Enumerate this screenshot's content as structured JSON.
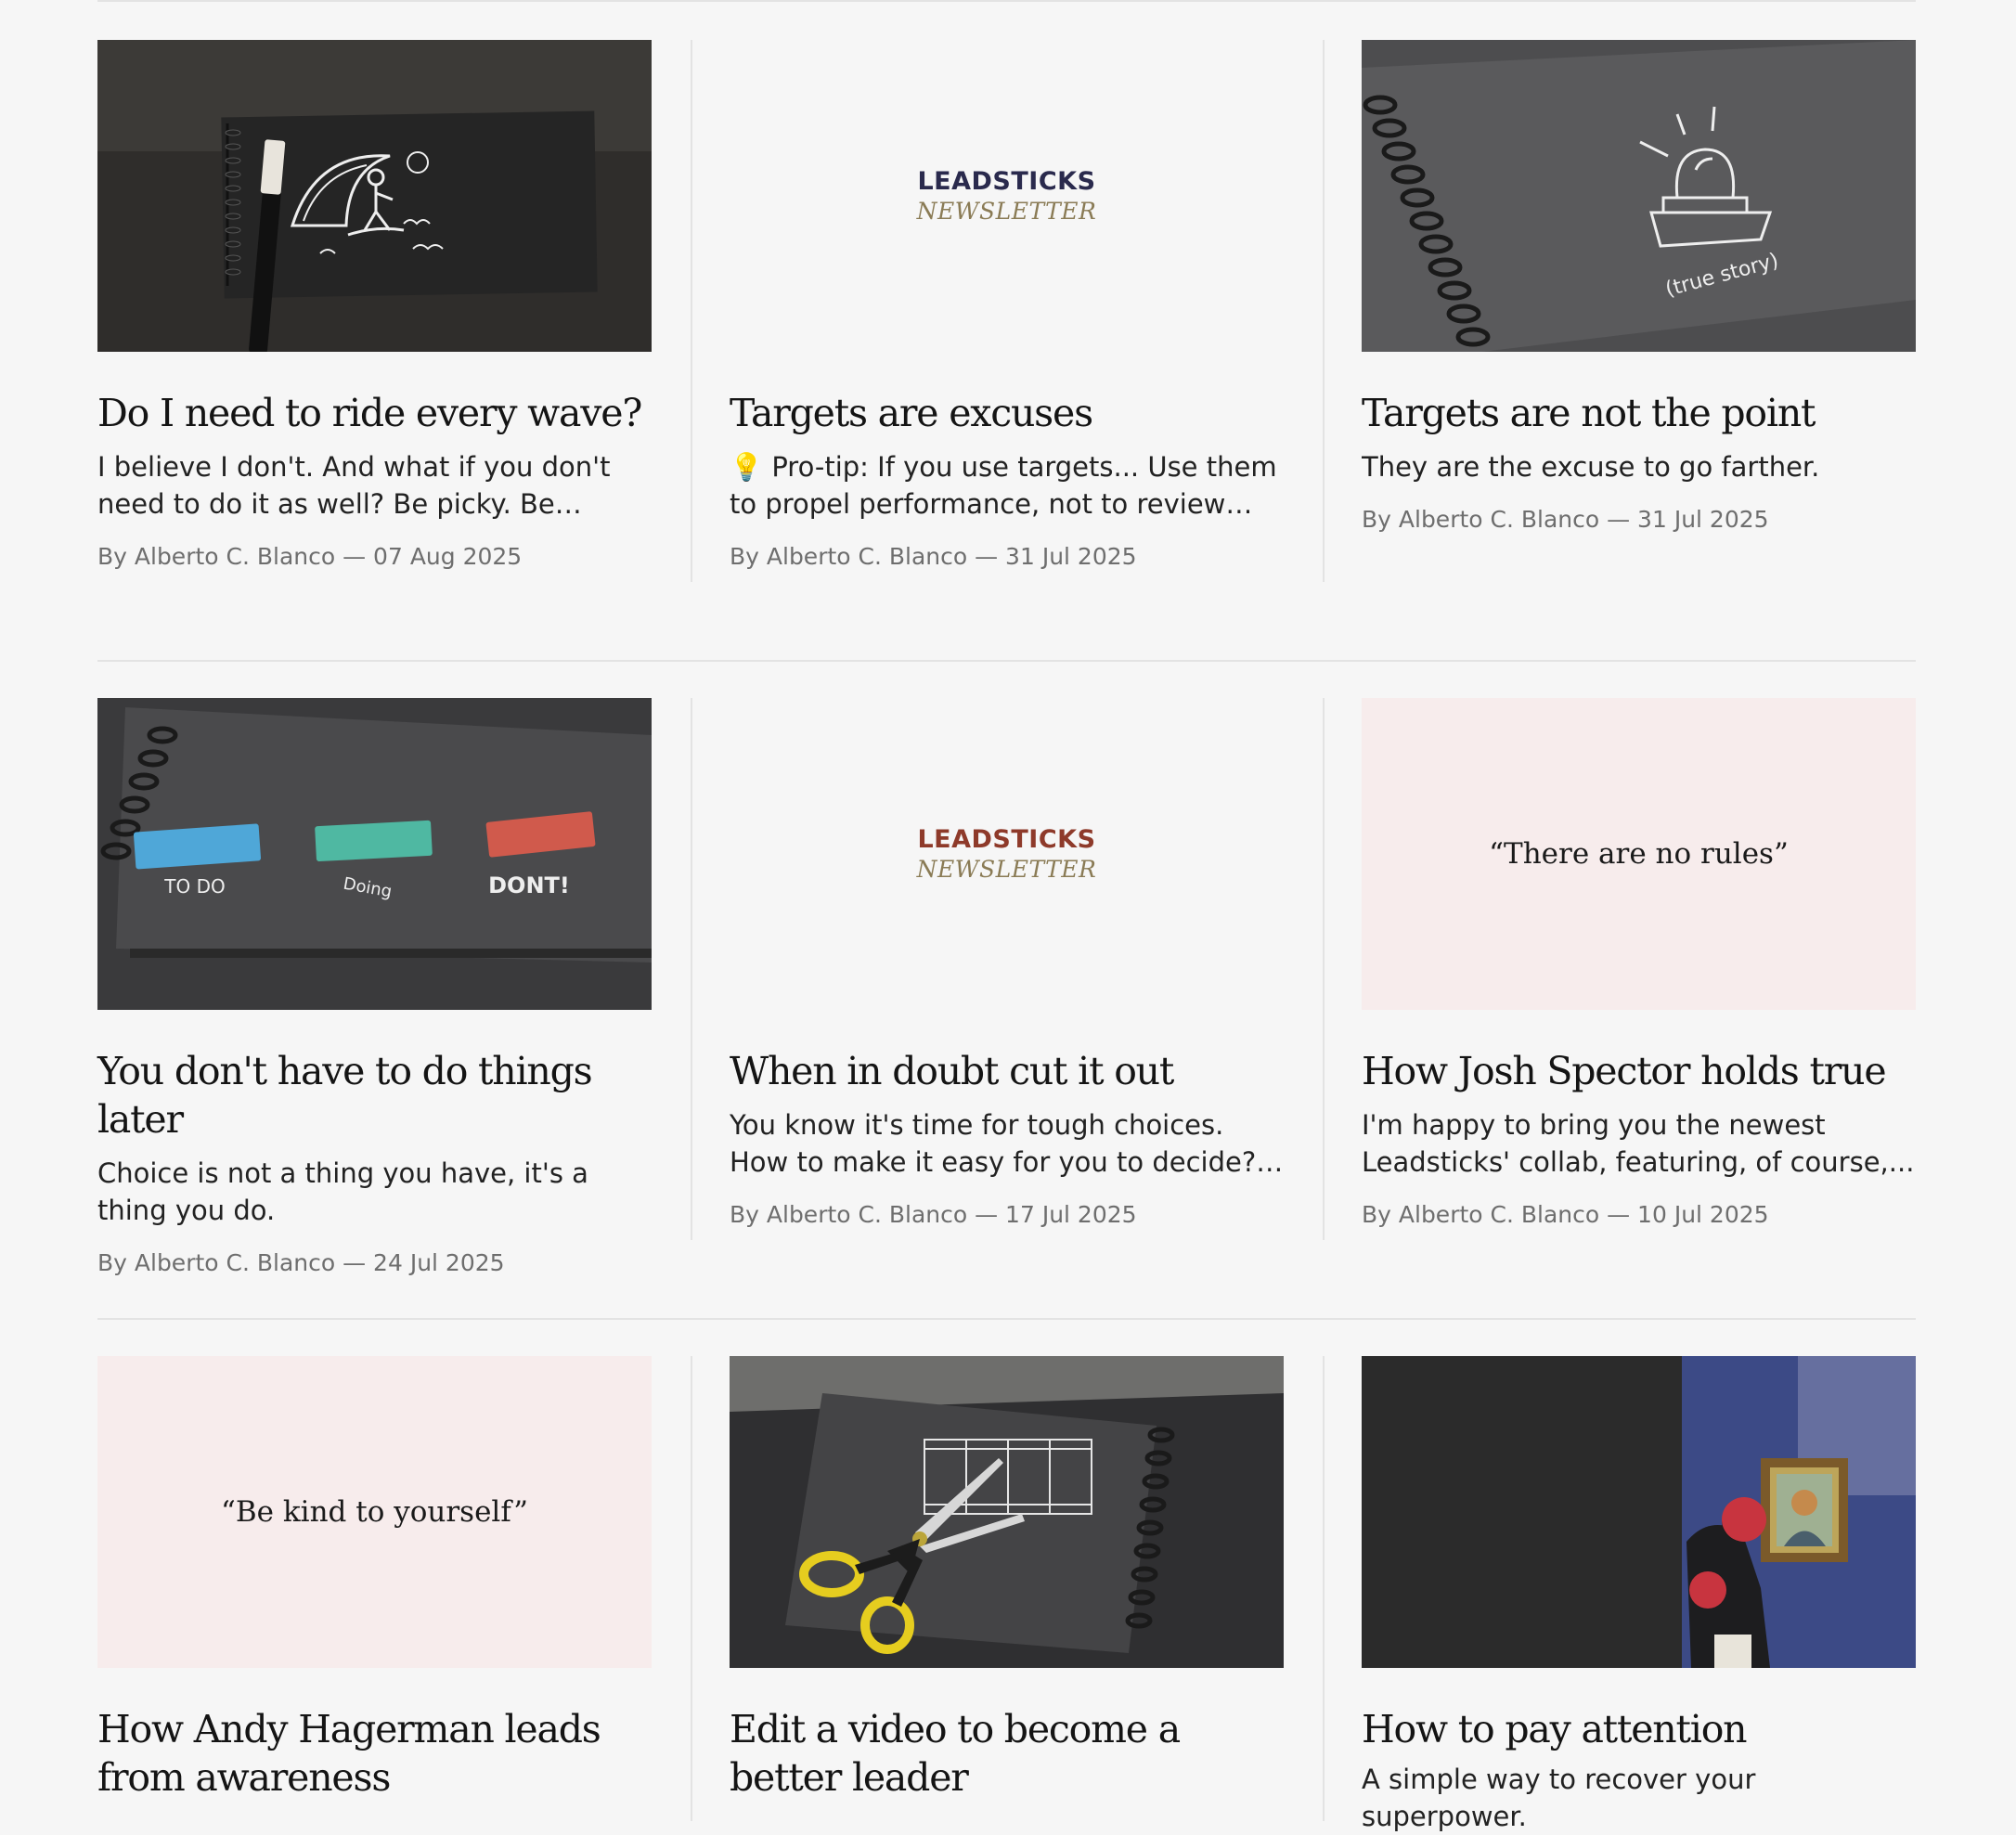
{
  "cards": [
    {
      "title": "Do I need to ride every wave?",
      "excerpt": "I believe I don't. And what if you don't need to do it as well? Be picky. Be observant....",
      "meta": "By Alberto C. Blanco — 07 Aug 2025",
      "image": "notebook-surfer-illustration"
    },
    {
      "title": "Targets are excuses",
      "excerpt": "💡 Pro-tip: If you use targets... Use them to propel performance, not to review how yo...",
      "meta": "By Alberto C. Blanco — 31 Jul 2025",
      "image": "leadsticks-newsletter-logo",
      "logo": {
        "word": "LEADSTICKS",
        "sub": "NEWSLETTER",
        "word_color": "#2a2a4d"
      }
    },
    {
      "title": "Targets are not the point",
      "excerpt": "They are the excuse to go farther.",
      "meta": "By Alberto C. Blanco — 31 Jul 2025",
      "image": "notebook-alarm-illustration",
      "image_caption": "(true story)"
    },
    {
      "title": "You don't have to do things later",
      "excerpt": "Choice is not a thing you have, it's a thing you do.",
      "meta": "By Alberto C. Blanco — 24 Jul 2025",
      "image": "notebook-sticky-notes",
      "image_labels": [
        "TO DO",
        "Doing",
        "DONT!"
      ]
    },
    {
      "title": "When in doubt cut it out",
      "excerpt": "You know it's time for tough choices. How to make it easy for you to decide? Read...",
      "meta": "By Alberto C. Blanco — 17 Jul 2025",
      "image": "leadsticks-newsletter-logo",
      "logo": {
        "word": "LEADSTICKS",
        "sub": "NEWSLETTER",
        "word_color": "#8e3a2a"
      }
    },
    {
      "title": "How Josh Spector holds true",
      "excerpt": "I'm happy to bring you the newest Leadsticks' collab, featuring, of course,...",
      "meta": "By Alberto C. Blanco — 10 Jul 2025",
      "image": "quote-card",
      "quote": "“There are no rules”"
    },
    {
      "title": "How Andy Hagerman leads from awareness",
      "excerpt": "",
      "meta": "",
      "image": "quote-card",
      "quote": "“Be kind to yourself”"
    },
    {
      "title": "Edit a video to become a better leader",
      "excerpt": "",
      "meta": "",
      "image": "notebook-scissors-film"
    },
    {
      "title": "How to pay attention",
      "excerpt": "A simple way to recover your superpower.",
      "meta": "",
      "image": "museum-van-gogh-photo"
    }
  ]
}
